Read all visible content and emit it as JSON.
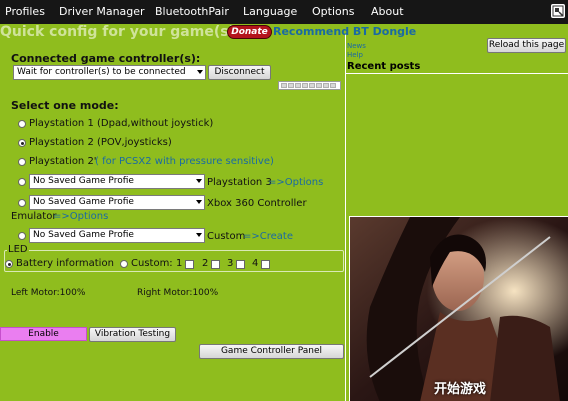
{
  "menu": {
    "items": [
      "Profiles",
      "Driver Manager",
      "BluetoothPair",
      "Language",
      "Options",
      "About"
    ]
  },
  "header": {
    "quick_config": "Quick config for your game(s)",
    "donate": "Donate",
    "recommend": "Recommend BT Dongle"
  },
  "connected": {
    "heading": "Connected game controller(s):",
    "select_value": "Wait for controller(s) to be connected",
    "disconnect": "Disconnect"
  },
  "modes": {
    "heading": "Select one mode:",
    "ps1": "Playstation 1 (Dpad,without joystick)",
    "ps2": "Playstation 2 (POV,joysticks)",
    "ps2p_label": "Playstation 2'",
    "ps2p_note": "( for PCSX2 with pressure sensitive)",
    "ps3_select": "No Saved Game Profie",
    "ps3_label": "Playstation 3",
    "ps3_link": "=>Options",
    "xbox_select": "No Saved Game Profie",
    "xbox_label": "Xbox 360 Controller",
    "emulator_label": "Emulator",
    "emulator_link": "=>Options",
    "custom_select": "No Saved Game Profie",
    "custom_label": "Custom",
    "custom_link": "=>Create",
    "selected": "ps2"
  },
  "led": {
    "legend": "LED",
    "battery": "Battery information",
    "custom": "Custom:",
    "channels": [
      "1",
      "2",
      "3",
      "4"
    ]
  },
  "motors": {
    "left": "Left Motor:100%",
    "right": "Right Motor:100%"
  },
  "buttons": {
    "enable": "Enable",
    "vibration": "Vibration Testing",
    "panel": "Game Controller Panel"
  },
  "right_panel": {
    "reload": "Reload this page",
    "news": "News",
    "help": "Help",
    "recent_posts": "Recent posts",
    "hero_caption": "开始游戏"
  },
  "colors": {
    "background": "#8fbd1e",
    "menubar": "#161616",
    "link": "#1a6aa3",
    "enable": "#ea7ef0",
    "donate": "#b4141c"
  },
  "icons": {
    "settings": "window-gear-icon"
  }
}
